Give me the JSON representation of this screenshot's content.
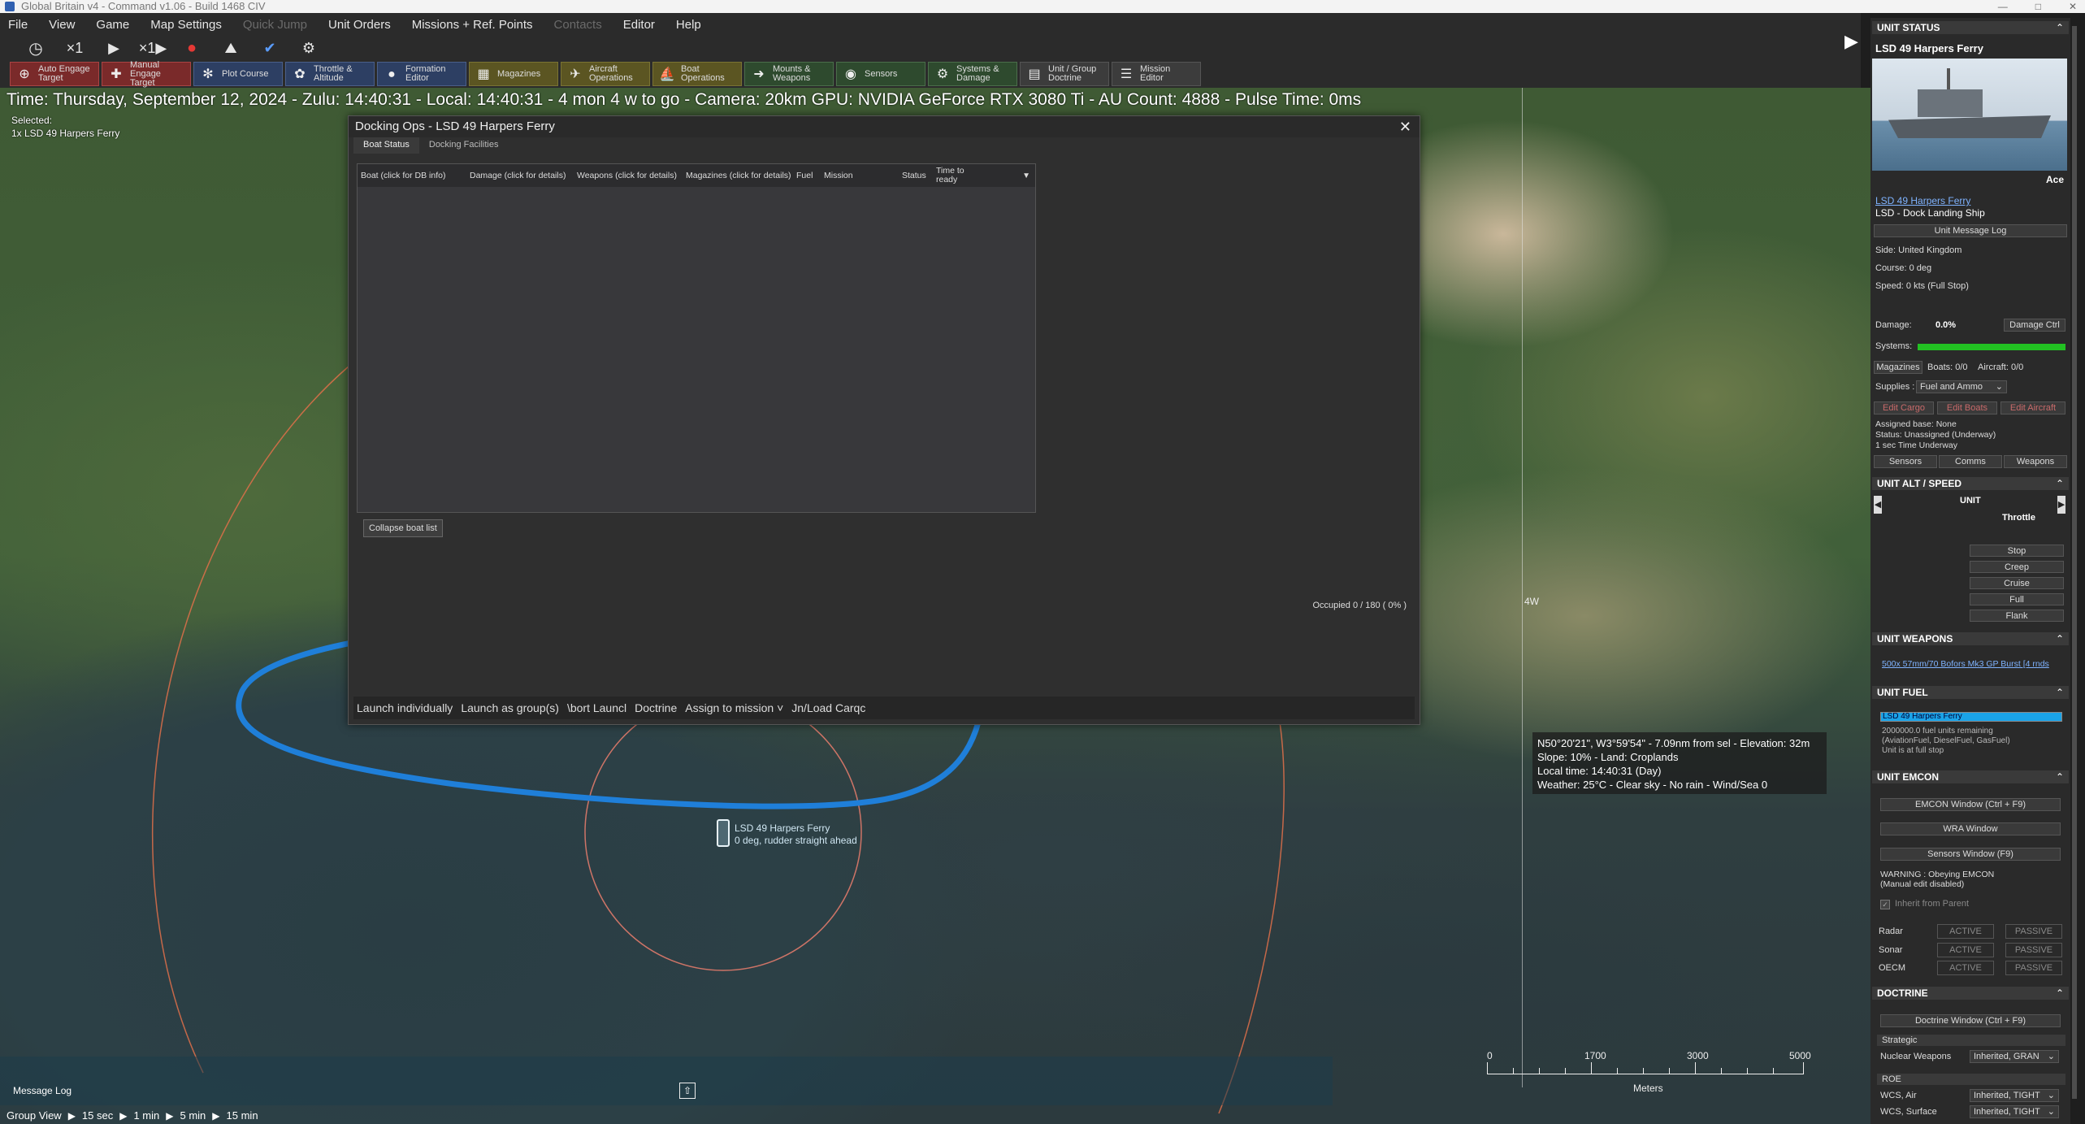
{
  "window": {
    "title": "Global Britain v4 - Command v1.06 - Build 1468 CIV",
    "controls": [
      "—",
      "□",
      "✕"
    ]
  },
  "menu": {
    "items": [
      {
        "label": "File",
        "enabled": true
      },
      {
        "label": "View",
        "enabled": true
      },
      {
        "label": "Game",
        "enabled": true
      },
      {
        "label": "Map Settings",
        "enabled": true
      },
      {
        "label": "Quick Jump",
        "enabled": false
      },
      {
        "label": "Unit Orders",
        "enabled": true
      },
      {
        "label": "Missions + Ref. Points",
        "enabled": true
      },
      {
        "label": "Contacts",
        "enabled": false
      },
      {
        "label": "Editor",
        "enabled": true
      },
      {
        "label": "Help",
        "enabled": true
      }
    ]
  },
  "speed": {
    "multiplier_a": "×1",
    "multiplier_b": "×1"
  },
  "toolbar": {
    "buttons": [
      {
        "label": "Auto Engage Target",
        "icon": "crosshair-icon",
        "color": "#7a2a2a"
      },
      {
        "label": "Manual Engage Target",
        "icon": "crosshair-manual-icon",
        "color": "#7a2a2a"
      },
      {
        "label": "Plot Course",
        "icon": "compass-icon",
        "color": "#2d3f63"
      },
      {
        "label": "Throttle & Altitude",
        "icon": "throttle-icon",
        "color": "#2d3f63"
      },
      {
        "label": "Formation Editor",
        "icon": "formation-icon",
        "color": "#2d3f63"
      },
      {
        "label": "Magazines",
        "icon": "magazine-icon",
        "color": "#5b5522"
      },
      {
        "label": "Aircraft Operations",
        "icon": "aircraft-icon",
        "color": "#5b5522"
      },
      {
        "label": "Boat Operations",
        "icon": "boat-icon",
        "color": "#5b5522"
      },
      {
        "label": "Mounts & Weapons",
        "icon": "weapons-icon",
        "color": "#2e4a2e"
      },
      {
        "label": "Sensors",
        "icon": "sensor-icon",
        "color": "#2e4a2e"
      },
      {
        "label": "Systems & Damage",
        "icon": "gear-icon",
        "color": "#2e4a2e"
      },
      {
        "label": "Unit / Group Doctrine",
        "icon": "doctrine-icon",
        "color": "#3c3c3c"
      },
      {
        "label": "Mission Editor",
        "icon": "mission-icon",
        "color": "#3c3c3c"
      }
    ]
  },
  "status_line": "Time: Thursday, September 12, 2024 - Zulu: 14:40:31 - Local: 14:40:31 - 4 mon 4 w to go - Camera: 20km GPU: NVIDIA GeForce RTX 3080 Ti - AU Count: 4888 - Pulse Time: 0ms",
  "selection": {
    "label": "Selected:",
    "value": "1x LSD 49 Harpers Ferry"
  },
  "docking": {
    "title": "Docking Ops - LSD 49 Harpers Ferry",
    "tabs": [
      {
        "label": "Boat Status",
        "active": true
      },
      {
        "label": "Docking Facilities",
        "active": false
      }
    ],
    "columns": [
      "Boat (click for DB info)",
      "Damage (click for details)",
      "Weapons (click for details)",
      "Magazines (click for details)",
      "Fuel",
      "Mission",
      "Status",
      "Time to ready"
    ],
    "collapse_label": "Collapse boat list",
    "occupied": "Occupied 0 / 180 ( 0% )",
    "actions": [
      "Launch individually",
      "Launch as group(s)",
      "\\bort Launcl",
      "Doctrine",
      "Assign to mission ˅",
      "Jn/Load Carqc"
    ]
  },
  "map": {
    "longitude_label": "4W",
    "unit_name": "LSD 49 Harpers Ferry",
    "unit_status": "0 deg, rudder straight ahead",
    "tooltip": [
      "N50°20'21\", W3°59'54\" - 7.09nm from sel - Elevation: 32m",
      "Slope: 10%  - Land: Croplands",
      "Local time: 14:40:31 (Day)",
      "Weather: 25°C - Clear sky - No rain - Wind/Sea 0"
    ],
    "scale": {
      "labels": [
        "0",
        "1700",
        "3000",
        "5000"
      ],
      "unit": "Meters"
    }
  },
  "bottom": {
    "message_log": "Message Log",
    "group_view": "Group View",
    "intervals": [
      "15 sec",
      "1 min",
      "5 min",
      "15 min"
    ]
  },
  "panel": {
    "unit_status_title": "UNIT STATUS",
    "unit_name": "LSD 49 Harpers Ferry",
    "pilot_rank": "Ace",
    "unit_link": "LSD 49 Harpers Ferry",
    "unit_class": "LSD - Dock Landing Ship",
    "message_log_btn": "Unit Message Log",
    "side": "Side: United Kingdom",
    "course": "Course: 0 deg",
    "speed": "Speed: 0 kts (Full Stop)",
    "damage_label": "Damage:",
    "damage_value": "0.0%",
    "damage_ctrl": "Damage Ctrl",
    "systems_label": "Systems:",
    "systems_level": 1.0,
    "magazines_btn": "Magazines",
    "boats": "Boats: 0/0",
    "aircraft": "Aircraft: 0/0",
    "supplies_label": "Supplies :",
    "supplies_value": "Fuel and Ammo",
    "edit_cargo": "Edit Cargo",
    "edit_boats": "Edit Boats",
    "edit_aircraft": "Edit Aircraft",
    "assigned_base": "Assigned base: None",
    "status": "Status: Unassigned (Underway)",
    "time_underway": "1 sec Time Underway",
    "tab_sensors": "Sensors",
    "tab_comms": "Comms",
    "tab_weapons": "Weapons",
    "alt_title": "UNIT ALT / SPEED",
    "unit_col": "UNIT",
    "throttle_col": "Throttle",
    "throttle_buttons": [
      "Stop",
      "Creep",
      "Cruise",
      "Full",
      "Flank"
    ],
    "weapons_title": "UNIT WEAPONS",
    "weapon_link": "500x 57mm/70 Bofors Mk3 GP Burst [4 rnds",
    "fuel_title": "UNIT FUEL",
    "fuel_unit": "LSD 49 Harpers Ferry",
    "fuel_level": 1.0,
    "fuel_remaining": "2000000.0 fuel units remaining",
    "fuel_types": "(AviationFuel, DieselFuel, GasFuel)",
    "fuel_state": "Unit is at full stop",
    "emcon_title": "UNIT EMCON",
    "emcon_window": "EMCON Window (Ctrl + F9)",
    "wra_window": "WRA Window",
    "sensors_window": "Sensors Window (F9)",
    "emcon_warning": "WARNING : Obeying EMCON",
    "emcon_warning2": "(Manual edit disabled)",
    "inherit": "Inherit from Parent",
    "emcon_rows": [
      {
        "label": "Radar",
        "active": "ACTIVE",
        "passive": "PASSIVE"
      },
      {
        "label": "Sonar",
        "active": "ACTIVE",
        "passive": "PASSIVE"
      },
      {
        "label": "OECM",
        "active": "ACTIVE",
        "passive": "PASSIVE"
      }
    ],
    "doctrine_title": "DOCTRINE",
    "doctrine_window": "Doctrine Window (Ctrl + F9)",
    "strategic": "Strategic",
    "nuclear_label": "Nuclear Weapons",
    "nuclear_value": "Inherited, GRAN",
    "roe": "ROE",
    "wcs_air_label": "WCS, Air",
    "wcs_air_value": "Inherited, TIGHT",
    "wcs_surface_label": "WCS, Surface",
    "wcs_surface_value": "Inherited, TIGHT"
  },
  "colors": {
    "annotation": "#1f7fd9",
    "range_ring": "#e0704a",
    "systems_bar": "#22c122",
    "fuel_bar": "#1aa3e8"
  }
}
